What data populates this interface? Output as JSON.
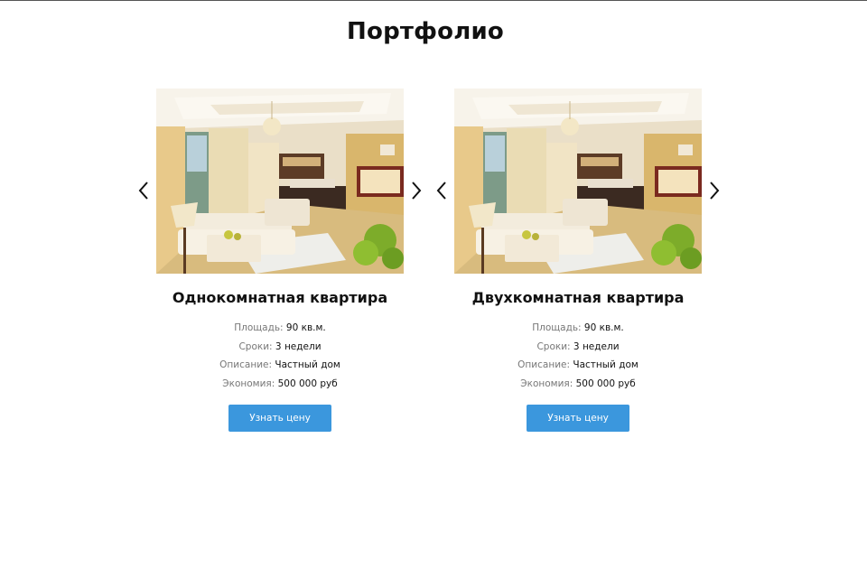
{
  "section": {
    "title": "Портфолио"
  },
  "cards": [
    {
      "title": "Однокомнатная квартира",
      "details": [
        {
          "label": "Площадь:",
          "value": "90 кв.м."
        },
        {
          "label": "Сроки:",
          "value": "3 недели"
        },
        {
          "label": "Описание:",
          "value": "Частный дом"
        },
        {
          "label": "Экономия:",
          "value": "500 000 руб"
        }
      ],
      "button_label": "Узнать цену"
    },
    {
      "title": "Двухкомнатная квартира",
      "details": [
        {
          "label": "Площадь:",
          "value": "90 кв.м."
        },
        {
          "label": "Сроки:",
          "value": "3 недели"
        },
        {
          "label": "Описание:",
          "value": "Частный дом"
        },
        {
          "label": "Экономия:",
          "value": "500 000 руб"
        }
      ],
      "button_label": "Узнать цену"
    }
  ],
  "icons": {
    "prev": "chevron-left-icon",
    "next": "chevron-right-icon"
  },
  "colors": {
    "button": "#3b97dd",
    "button_text": "#ffffff",
    "label": "#777777",
    "text": "#111111"
  }
}
